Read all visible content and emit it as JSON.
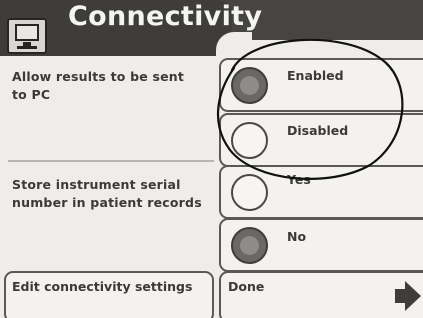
{
  "header": {
    "title": "Connectivity",
    "icon": "monitor-icon"
  },
  "sections": [
    {
      "label": "Allow results to be sent to PC",
      "options": [
        {
          "label": "Enabled",
          "selected": true
        },
        {
          "label": "Disabled",
          "selected": false
        }
      ]
    },
    {
      "label": "Store instrument serial number in patient records",
      "options": [
        {
          "label": "Yes",
          "selected": false
        },
        {
          "label": "No",
          "selected": true
        }
      ]
    }
  ],
  "footer": {
    "edit_label": "Edit connectivity settings",
    "done_label": "Done",
    "done_icon": "arrow-right-icon"
  },
  "colors": {
    "header_bg": "#3f3d3c",
    "panel_bg": "#efedea",
    "text": "#3b3a39",
    "annotation": "#111111"
  }
}
